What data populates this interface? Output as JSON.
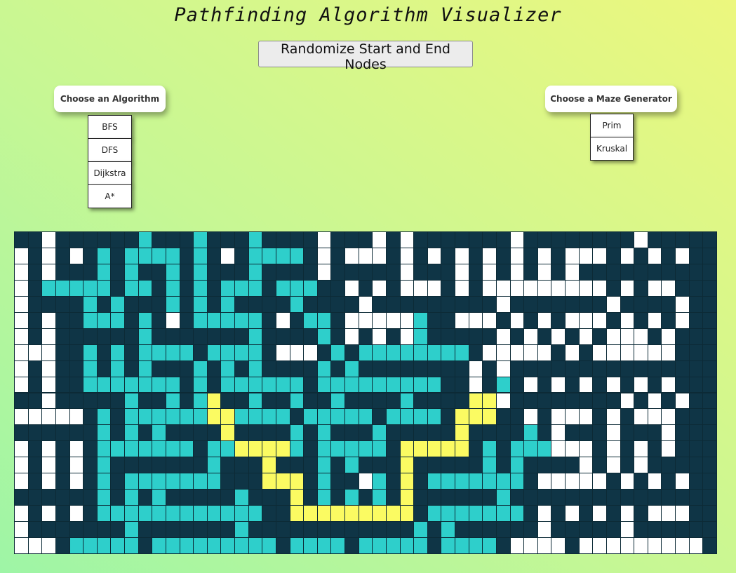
{
  "title": "Pathfinding Algorithm Visualizer",
  "randomize_label": "Randomize Start and End Nodes",
  "algorithm_panel": {
    "title": "Choose an Algorithm",
    "options": [
      "BFS",
      "DFS",
      "Dijkstra",
      "A*"
    ]
  },
  "maze_panel": {
    "title": "Choose a Maze Generator",
    "options": [
      "Prim",
      "Kruskal"
    ]
  },
  "colors": {
    "wall": "#0f3546",
    "open": "#ffffff",
    "visited": "#2ecfcb",
    "path": "#fbfb62"
  },
  "grid": {
    "legend": {
      "W": "wall",
      ".": "open",
      "V": "visited",
      "P": "path"
    },
    "rows": [
      "WW.WWWWWWVWWWVWWWVWWWW.WWW.W.WWWWWWW.WWWWWWWW.WWW",
      ".W.W.WVWVVVVWVW.WVVVVW.W...W.W.W.W.W.W.W...W.W.W.",
      ".W.WWWVWVWWVWVWWWVWWWW.WWWWW.WWW.W.W.W.W.WWWWWWWW",
      ".WVVVVVWVVWVWVWVVVWVVVWW.W.W...W.W.........W.W..W",
      ".WWWWVWVWWWVWVWVWWWWVWWWW.WWWWWWWWW.WWWWWWW.WWWW.",
      ".W.WWVVVWVW.WVVVVVW.WVVW.....VWW...W.W.W...W.W.W.",
      ".W.WWWWWWVWWWWWWWVWWWWVW.W.W.VWWWWW.W.W.W.W...W.W",
      "...WWVWVWVVVVWVVVVW...WVWVVVVVVVVW.....W.W......",
      ".W.WWVWVWVWWWVWVWVWWWWVWVWWWWWWWW.W.WWWWWWWWWWWWW",
      ".W.WWVVVVVVVWVWVVVVVVWVVVVVVVVVWW.WVW.W.W.W.W.W.W",
      "WW.WWWWWVWWVWVPWWVWWVWWVWWWWVWWWWPP.WWWWWWWW.W.W.",
      ".....WVWVVVVVVPPVVVVWVVVVVWVVVVWPPPWW.W...W.W...W",
      "WWWWWWVWVWVWWWWPWWWWVWVWWWVWWWWWPWWWWVW.WWW.WWW.W",
      ".W.W.WVVVVVVVWVVPPPPVWVVVVVWPPPPPWVWVVV...W.W.W.W",
      ".W.W.WVWWWWWWWVWWWPWWWVWVWWWPWWWWWVWVWWWW.W.W.WWW",
      ".W.W.WVWVVVVVVVWWWPPPWVWW.VWPWVVVVVVVW.....W.W.W.",
      "WWWWWWVWVWVWWWWWVWWWPWVWVWVWPWWWWWWVWWWWWWWWWWWWW",
      ".W.W.WVVVVVVVVVVVVWWPPPPPPPPPWVVVVVVVW.W.W.W.W...",
      ".WWWWWWWVWWWWWWWVWWWWWWWWWWWWVWVWWWWWW.WWWWW.WWWWW",
      "...WVVVVVWVVVVVVVVVWVVVVWVVVVVWVVVVW....W.........W"
    ]
  }
}
